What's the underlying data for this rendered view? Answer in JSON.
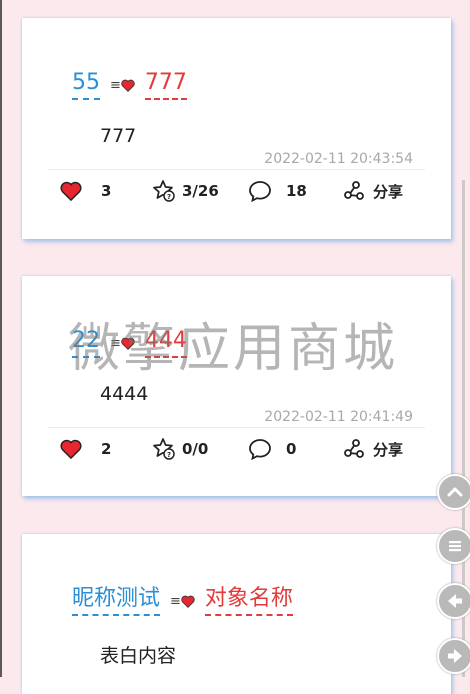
{
  "posts": [
    {
      "nickname": "55",
      "target": "777",
      "content": "777",
      "time": "2022-02-11 20:43:54",
      "likes": "3",
      "wishes": "3/26",
      "comments": "18",
      "share": "分享"
    },
    {
      "nickname": "22",
      "target": "444",
      "content": "4444",
      "time": "2022-02-11 20:41:49",
      "likes": "2",
      "wishes": "0/0",
      "comments": "0",
      "share": "分享"
    },
    {
      "nickname": "昵称测试",
      "target": "对象名称",
      "content": "表白内容"
    }
  ],
  "watermark": "微擎应用商城",
  "colors": {
    "nickname": "#2a8fd6",
    "target": "#e33b3b",
    "heart": "#e8262f",
    "background": "#fbe9ee"
  },
  "fabs": [
    "up-arrow-icon",
    "menu-icon",
    "back-arrow-icon",
    "forward-arrow-icon"
  ]
}
